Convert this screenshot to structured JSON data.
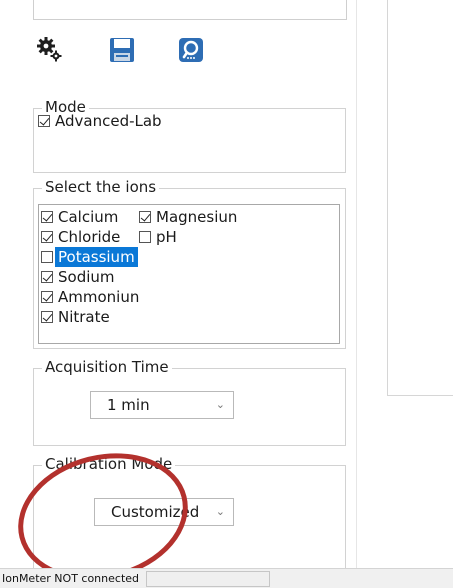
{
  "toolbar": {
    "icons": [
      "gear-icon",
      "save-icon",
      "search-icon"
    ]
  },
  "mode": {
    "legend": "Mode",
    "advanced_lab": {
      "label": "Advanced-Lab",
      "checked": true
    }
  },
  "ions": {
    "legend": "Select the ions",
    "items": [
      {
        "label": "Calcium",
        "checked": true
      },
      {
        "label": "Magnesiun",
        "checked": true
      },
      {
        "label": "Chloride",
        "checked": true
      },
      {
        "label": "pH",
        "checked": false
      },
      {
        "label": "Potassium",
        "checked": false,
        "selected": true
      },
      {
        "label": "Sodium",
        "checked": true
      },
      {
        "label": "Ammoniun",
        "checked": true
      },
      {
        "label": "Nitrate",
        "checked": true
      }
    ]
  },
  "acquisition": {
    "legend": "Acquisition Time",
    "value": "1 min"
  },
  "calibration": {
    "legend": "Calibration Mode",
    "value": "Customized"
  },
  "status": {
    "text": "IonMeter NOT connected",
    "field": ""
  },
  "colors": {
    "selection": "#0a78d7",
    "highlight_ellipse": "#b3312d",
    "save_icon": "#2e6db4",
    "search_icon": "#2e6db4"
  }
}
